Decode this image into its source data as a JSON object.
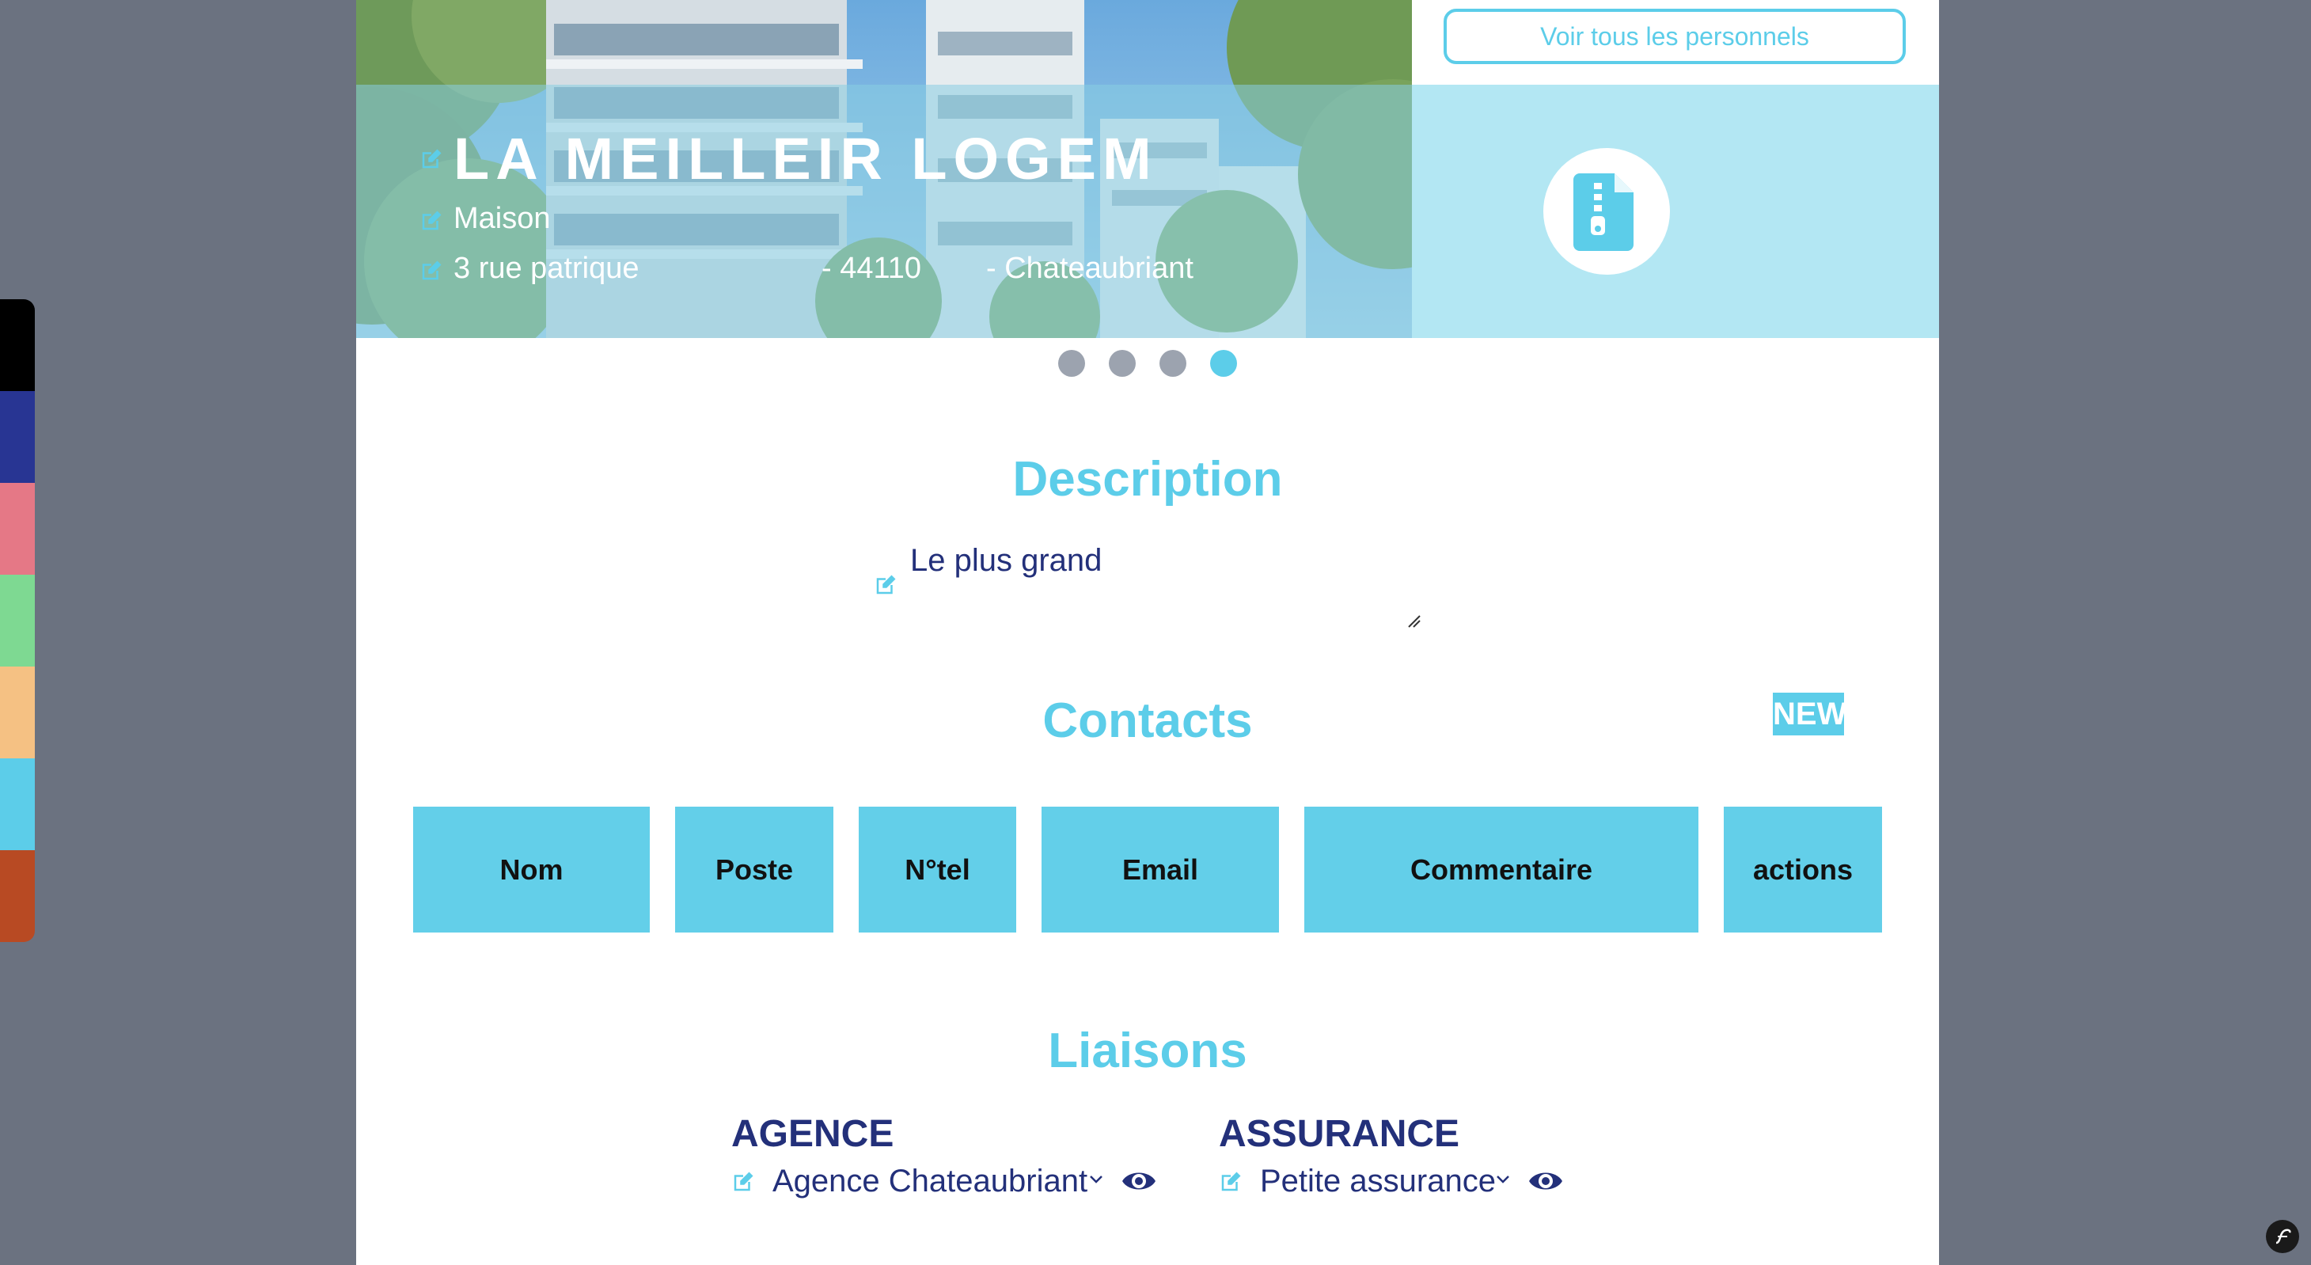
{
  "palette": [
    "#000000",
    "#283593",
    "#e57886",
    "#7ed992",
    "#f5c183",
    "#5ccde9",
    "#b84a23"
  ],
  "accent_color": "#5ccde9",
  "dark_text_color": "#23307a",
  "header": {
    "all_staff_button": "Voir tous les personnels",
    "file_icon": "zip-file-icon"
  },
  "property": {
    "name": "LA MEILLEIR LOGEM",
    "type": "Maison",
    "street": "3 rue patrique",
    "postal_code": "- 44110",
    "city": "- Chateaubriant"
  },
  "carousel": {
    "count": 4,
    "active_index": 4
  },
  "description": {
    "title": "Description",
    "text": "Le plus grand"
  },
  "contacts": {
    "title": "Contacts",
    "new_button": "NEW",
    "columns": [
      "Nom",
      "Poste",
      "N°tel",
      "Email",
      "Commentaire",
      "actions"
    ]
  },
  "liaisons": {
    "title": "Liaisons",
    "agence": {
      "label": "AGENCE",
      "value": "Agence Chateaubriant"
    },
    "assurance": {
      "label": "ASSURANCE",
      "value": "Petite assurance"
    }
  }
}
